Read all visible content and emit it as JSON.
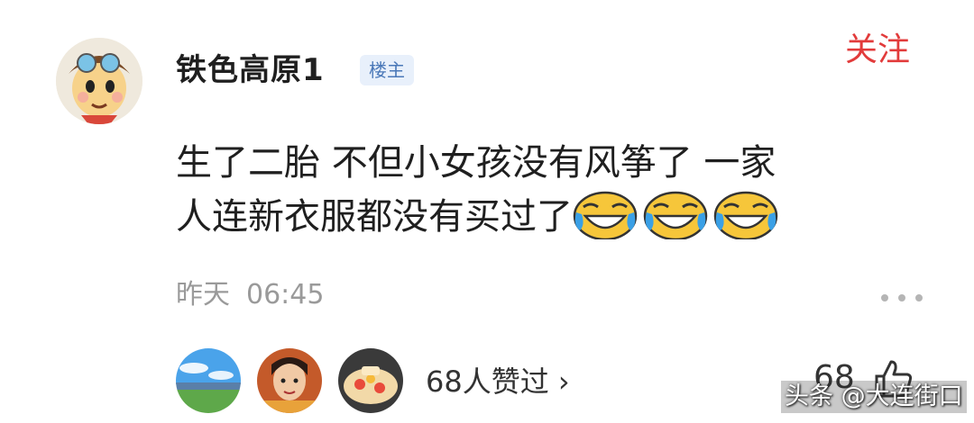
{
  "comment": {
    "username": "铁色高原1",
    "badge": "楼主",
    "follow_label": "关注",
    "text_line1": "生了二胎 不但小女孩没有风筝了 一家",
    "text_line2": "人连新衣服都没有买过了",
    "emoji_icons": [
      "laughing-tears-icon",
      "laughing-tears-icon",
      "laughing-tears-icon"
    ],
    "date": "昨天",
    "time": "06:45"
  },
  "likes": {
    "summary": "68人赞过 ›",
    "count": "68"
  },
  "watermark": "头条 @大连街口",
  "colors": {
    "follow": "#e23b3b",
    "badge_bg": "#e8f0fb",
    "badge_text": "#4a78b8",
    "meta": "#9a9a9a"
  }
}
